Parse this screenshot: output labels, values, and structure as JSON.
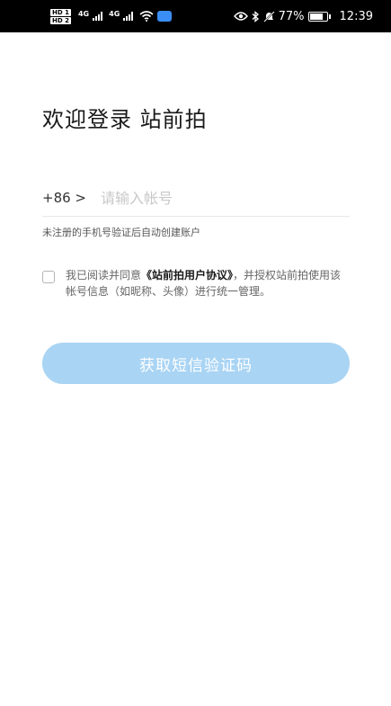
{
  "status_bar": {
    "hd_badges": [
      "HD 1",
      "HD 2"
    ],
    "network_labels": [
      "4G",
      "4G"
    ],
    "battery_percent": "77%",
    "time": "12:39",
    "icons": [
      "eye-icon",
      "bluetooth-icon",
      "mute-icon",
      "wifi-icon",
      "cloud-icon",
      "battery-icon"
    ]
  },
  "login": {
    "title": "欢迎登录 站前拍",
    "country_code": "+86 >",
    "phone_placeholder": "请输入帐号",
    "hint": "未注册的手机号验证后自动创建账户",
    "agreement": {
      "prefix": "我已阅读并同意",
      "link": "《站前拍用户协议》",
      "suffix": "，并授权站前拍使用该帐号信息（如昵称、头像）进行统一管理。",
      "checked": false
    },
    "submit_label": "获取短信验证码",
    "submit_color": "#a9d4f4"
  }
}
